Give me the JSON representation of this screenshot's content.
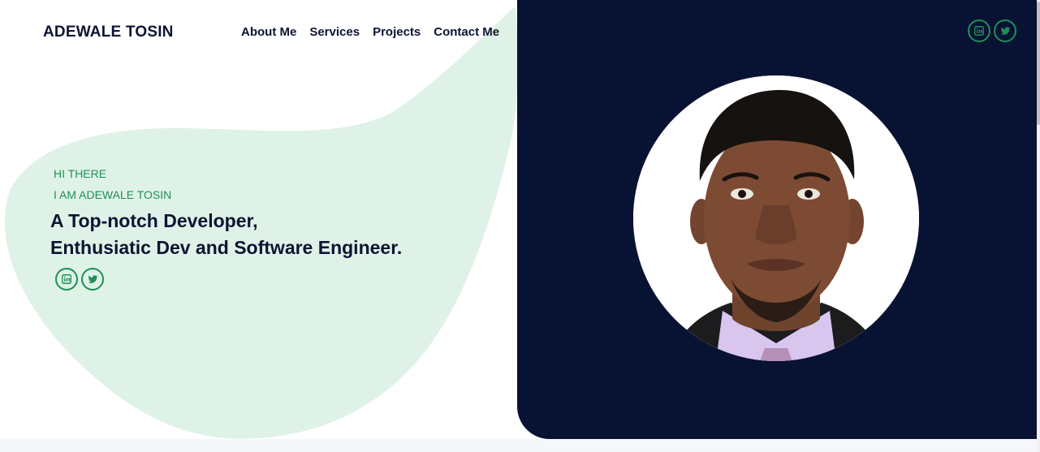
{
  "brand": {
    "name": "ADEWALE TOSIN"
  },
  "nav": {
    "items": [
      "About Me",
      "Services",
      "Projects",
      "Contact Me"
    ]
  },
  "hero": {
    "greeting": "HI THERE",
    "intro": "I AM ADEWALE TOSIN",
    "headline_line1": "A Top-notch Developer,",
    "headline_line2": "Enthusiatic Dev and Software Engineer."
  },
  "social": {
    "icons": [
      "linkedin-icon",
      "twitter-icon"
    ]
  },
  "colors": {
    "accent": "#1f8f55",
    "dark_panel": "#081233",
    "blob": "#dff2e7",
    "text_dark": "#0c1433"
  }
}
